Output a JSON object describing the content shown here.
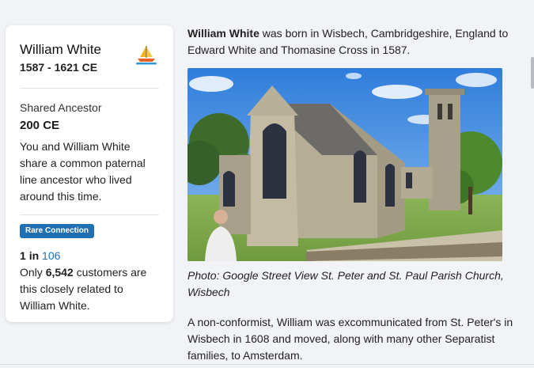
{
  "profile": {
    "name": "William White",
    "years": "1587 - 1621 CE",
    "icon": "sailboat-icon",
    "shared_label": "Shared Ancestor",
    "shared_value": "200 CE",
    "shared_desc": "You and William White share a common paternal line ancestor who lived around this time.",
    "badge": "Rare Connection",
    "ratio_one": "1",
    "ratio_in": "in",
    "ratio_num": "106",
    "customers_prefix": "Only",
    "customers_count": "6,542",
    "customers_suffix": "customers are this closely related to William White."
  },
  "article": {
    "intro_name": "William White",
    "intro_text": " was born in Wisbech, Cambridgeshire, England to Edward White and Thomasine Cross in 1587.",
    "photo_caption": "Photo: Google Street View St. Peter and St. Paul Parish Church, Wisbech",
    "paragraph": "A non-conformist, William was excommunicated from St. Peter's in Wisbech in 1608 and moved, along with many other Separatist families, to Amsterdam."
  },
  "colors": {
    "accent": "#1f6fb5",
    "background": "#f1f3f6"
  }
}
